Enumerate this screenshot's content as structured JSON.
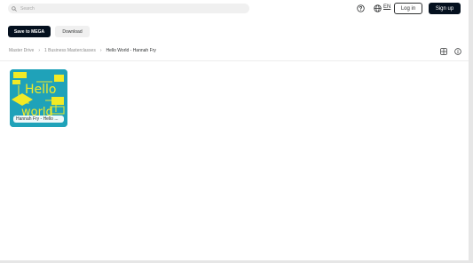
{
  "search": {
    "placeholder": "Search"
  },
  "header": {
    "language": "EN",
    "login_label": "Log in",
    "signup_label": "Sign up"
  },
  "actions": {
    "save_label": "Save to MEGA",
    "download_label": "Download"
  },
  "breadcrumb": {
    "items": [
      "Master Drive",
      "1 Business Masterclasses",
      "Hello World - Hannah Fry"
    ]
  },
  "files": [
    {
      "name": "Hannah Fry - Hello ...",
      "thumbnail_text": "Hello world",
      "thumbnail_colors": {
        "background": "#1fa2b9",
        "accent": "#f2ea25"
      }
    }
  ],
  "colors": {
    "primary_button": "#04101e",
    "secondary_button": "#f0f0f0"
  }
}
